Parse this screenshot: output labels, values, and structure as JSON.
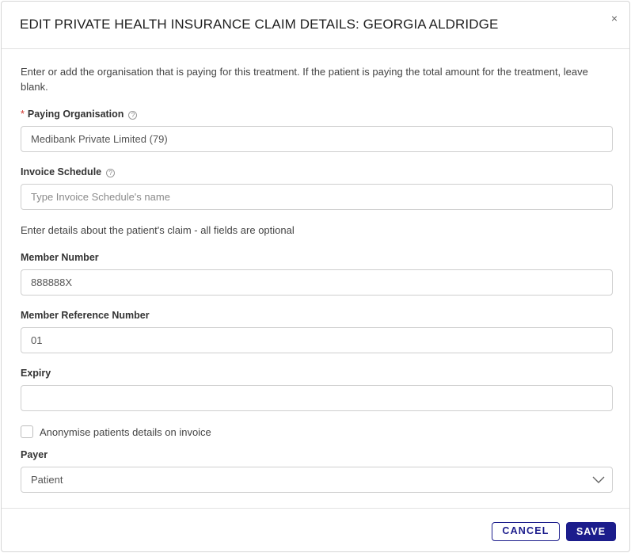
{
  "modal": {
    "title": "EDIT PRIVATE HEALTH INSURANCE CLAIM DETAILS: GEORGIA ALDRIDGE",
    "close_symbol": "×"
  },
  "intro_text": "Enter or add the organisation that is paying for this treatment. If the patient is paying the total amount for the treatment, leave blank.",
  "paying_organisation": {
    "required_marker": "*",
    "label": "Paying Organisation",
    "value": "Medibank Private Limited (79)"
  },
  "invoice_schedule": {
    "label": "Invoice Schedule",
    "placeholder": "Type Invoice Schedule's name"
  },
  "claim_section_text": "Enter details about the patient's claim - all fields are optional",
  "member_number": {
    "label": "Member Number",
    "value": "888888X"
  },
  "member_reference_number": {
    "label": "Member Reference Number",
    "value": "01"
  },
  "expiry": {
    "label": "Expiry",
    "value": ""
  },
  "anonymise": {
    "label": "Anonymise patients details on invoice",
    "checked": false
  },
  "payer": {
    "label": "Payer",
    "value": "Patient"
  },
  "footer": {
    "cancel_label": "CANCEL",
    "save_label": "SAVE"
  },
  "colors": {
    "primary": "#1c1d8c",
    "required": "#d0342c"
  },
  "icons": {
    "help": "help-circle-icon",
    "close": "close-icon",
    "chevron": "chevron-down-icon"
  }
}
